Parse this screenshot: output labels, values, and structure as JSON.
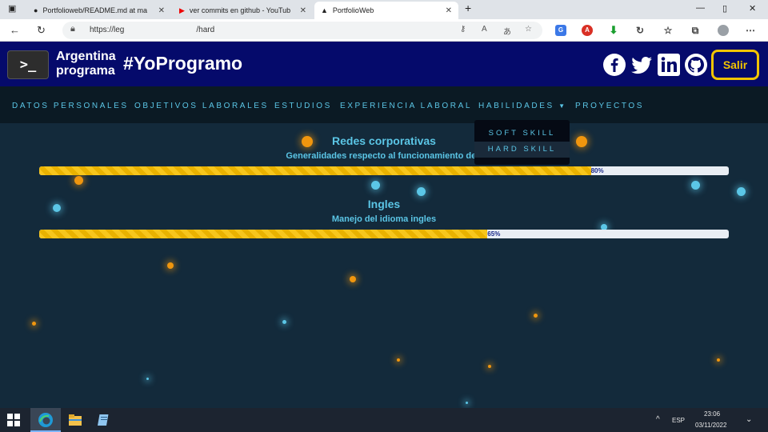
{
  "browser": {
    "tabs": [
      {
        "title": "Portfolioweb/README.md at ma"
      },
      {
        "title": "ver commits en github - YouTub"
      },
      {
        "title": "PortfolioWeb"
      }
    ],
    "url_prefix": "https://leg",
    "url_suffix": "/hard"
  },
  "header": {
    "logo_glyph": ">_",
    "brand_line1": "Argentina",
    "brand_line2": "programa",
    "hashtag": "#YoProgramo",
    "logout_label": "Salir"
  },
  "nav": {
    "items": [
      "DATOS PERSONALES",
      "OBJETIVOS LABORALES",
      "ESTUDIOS",
      "EXPERIENCIA LABORAL",
      "HABILIDADES",
      "PROYECTOS"
    ],
    "dropdown": [
      "SOFT SKILL",
      "HARD SKILL"
    ]
  },
  "skills": [
    {
      "title": "Redes corporativas",
      "subtitle": "Generalidades respecto al funcionamiento de r",
      "percent": 80,
      "percent_label": "80%"
    },
    {
      "title": "Ingles",
      "subtitle": "Manejo del idioma ingles",
      "percent": 65,
      "percent_label": "65%"
    }
  ],
  "taskbar": {
    "lang": "ESP",
    "time": "23:06",
    "date": "03/11/2022"
  },
  "colors": {
    "header_bg": "#050a6b",
    "accent_yellow": "#f2c400",
    "accent_cyan": "#5bc6e6",
    "dot_orange": "#f0960e"
  }
}
